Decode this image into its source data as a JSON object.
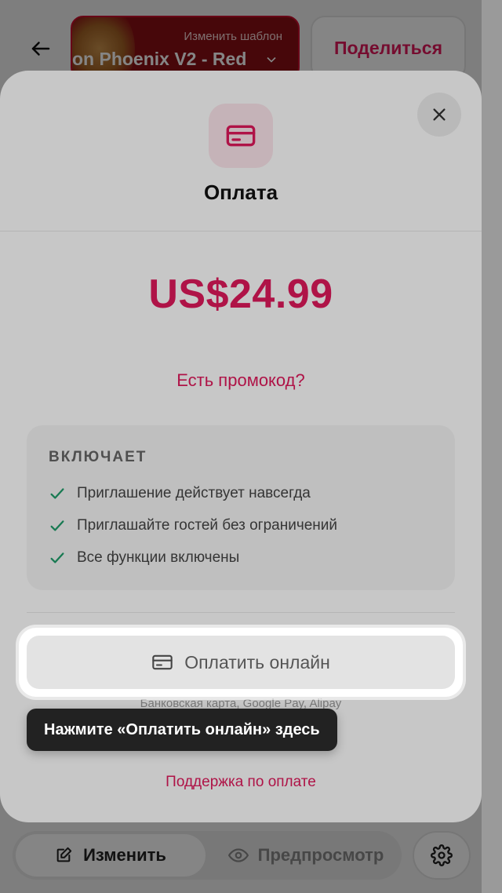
{
  "header": {
    "template_hint": "Изменить шаблон",
    "template_name": "on Phoenix V2 - Red",
    "share_label": "Поделиться"
  },
  "bottom_bar": {
    "edit_label": "Изменить",
    "preview_label": "Предпросмотр"
  },
  "payment": {
    "title": "Оплата",
    "price": "US$24.99",
    "promo_link": "Есть промокод?",
    "includes_header": "ВКЛЮЧАЕТ",
    "features": [
      "Приглашение действует навсегда",
      "Приглашайте гостей без ограничений",
      "Все функции включены"
    ],
    "pay_button_label": "Оплатить онлайн",
    "methods_text": "Банковская карта, Google Pay, Alipay",
    "support_link": "Поддержка по оплате"
  },
  "tooltip": {
    "text": "Нажмите «Оплатить онлайн» здесь"
  },
  "colors": {
    "accent": "#e0195c",
    "check": "#1f9d6a",
    "tooltip_bg": "#222222"
  }
}
